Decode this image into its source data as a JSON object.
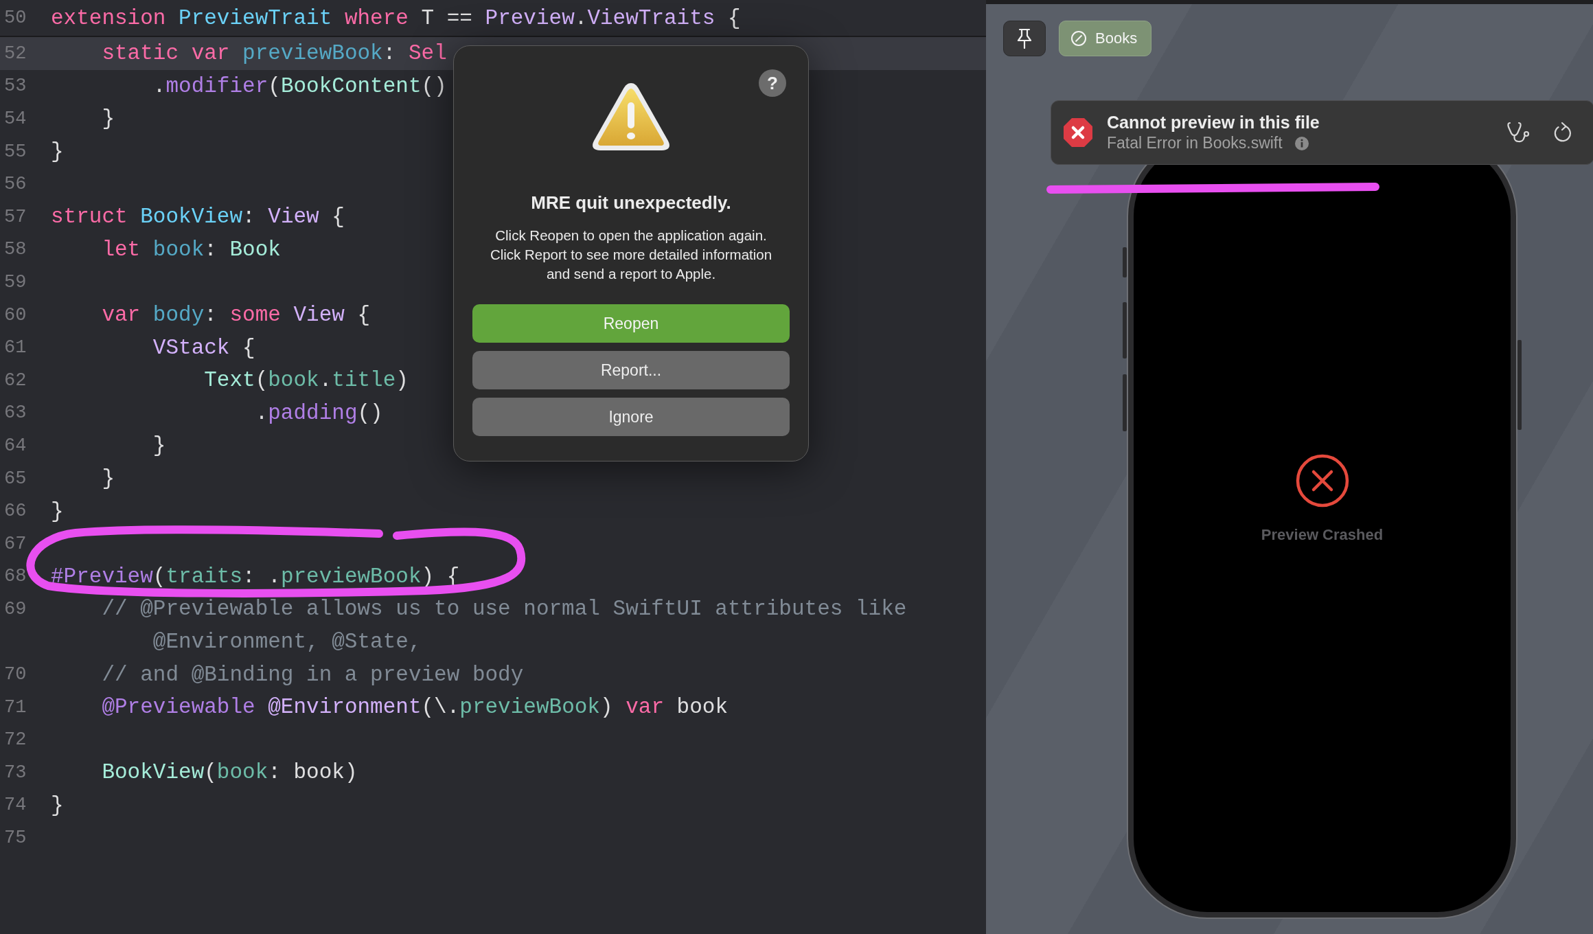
{
  "editor": {
    "sticky_header": {
      "number": "50",
      "tokens": [
        {
          "text": "extension",
          "kind": "keyword"
        },
        {
          "text": " PreviewTrait",
          "kind": "decl-type"
        },
        {
          "text": " where",
          "kind": "keyword"
        },
        {
          "text": " T == ",
          "kind": "plain"
        },
        {
          "text": "Preview",
          "kind": "system-type"
        },
        {
          "text": ".",
          "kind": "plain"
        },
        {
          "text": "ViewTraits",
          "kind": "system-type"
        },
        {
          "text": " {",
          "kind": "plain"
        }
      ]
    },
    "lines": [
      {
        "number": "52",
        "current": true,
        "tokens": [
          {
            "text": "    static",
            "kind": "keyword"
          },
          {
            "text": " var",
            "kind": "keyword"
          },
          {
            "text": " previewBook",
            "kind": "decl-name"
          },
          {
            "text": ": ",
            "kind": "plain"
          },
          {
            "text": "Sel",
            "kind": "keyword"
          }
        ]
      },
      {
        "number": "53",
        "current": false,
        "tokens": [
          {
            "text": "        .",
            "kind": "plain"
          },
          {
            "text": "modifier",
            "kind": "system-func"
          },
          {
            "text": "(",
            "kind": "plain"
          },
          {
            "text": "BookContent",
            "kind": "project-type"
          },
          {
            "text": "()",
            "kind": "plain"
          }
        ]
      },
      {
        "number": "54",
        "current": false,
        "tokens": [
          {
            "text": "    }",
            "kind": "plain"
          }
        ]
      },
      {
        "number": "55",
        "current": false,
        "tokens": [
          {
            "text": "}",
            "kind": "plain"
          }
        ]
      },
      {
        "number": "56",
        "current": false
      },
      {
        "number": "57",
        "current": false,
        "tokens": [
          {
            "text": "struct",
            "kind": "keyword"
          },
          {
            "text": " BookView",
            "kind": "decl-type"
          },
          {
            "text": ": ",
            "kind": "plain"
          },
          {
            "text": "View",
            "kind": "system-type"
          },
          {
            "text": " {",
            "kind": "plain"
          }
        ]
      },
      {
        "number": "58",
        "current": false,
        "tokens": [
          {
            "text": "    let",
            "kind": "keyword"
          },
          {
            "text": " book",
            "kind": "decl-name"
          },
          {
            "text": ": ",
            "kind": "plain"
          },
          {
            "text": "Book",
            "kind": "project-type"
          }
        ]
      },
      {
        "number": "59",
        "current": false
      },
      {
        "number": "60",
        "current": false,
        "tokens": [
          {
            "text": "    var",
            "kind": "keyword"
          },
          {
            "text": " body",
            "kind": "decl-name"
          },
          {
            "text": ": ",
            "kind": "plain"
          },
          {
            "text": "some",
            "kind": "keyword"
          },
          {
            "text": " View",
            "kind": "system-type"
          },
          {
            "text": " {",
            "kind": "plain"
          }
        ]
      },
      {
        "number": "61",
        "current": false,
        "tokens": [
          {
            "text": "        VStack",
            "kind": "system-type"
          },
          {
            "text": " {",
            "kind": "plain"
          }
        ]
      },
      {
        "number": "62",
        "current": false,
        "tokens": [
          {
            "text": "            Text",
            "kind": "project-type"
          },
          {
            "text": "(",
            "kind": "plain"
          },
          {
            "text": "book",
            "kind": "project-prop"
          },
          {
            "text": ".",
            "kind": "plain"
          },
          {
            "text": "title",
            "kind": "project-prop"
          },
          {
            "text": ")",
            "kind": "plain"
          }
        ]
      },
      {
        "number": "63",
        "current": false,
        "tokens": [
          {
            "text": "                .",
            "kind": "plain"
          },
          {
            "text": "padding",
            "kind": "system-func"
          },
          {
            "text": "()",
            "kind": "plain"
          }
        ]
      },
      {
        "number": "64",
        "current": false,
        "tokens": [
          {
            "text": "        }",
            "kind": "plain"
          }
        ]
      },
      {
        "number": "65",
        "current": false,
        "tokens": [
          {
            "text": "    }",
            "kind": "plain"
          }
        ]
      },
      {
        "number": "66",
        "current": false,
        "tokens": [
          {
            "text": "}",
            "kind": "plain"
          }
        ]
      },
      {
        "number": "67",
        "current": false
      },
      {
        "number": "68",
        "current": false,
        "tokens": [
          {
            "text": "#Preview",
            "kind": "system-func"
          },
          {
            "text": "(",
            "kind": "plain"
          },
          {
            "text": "traits",
            "kind": "project-prop"
          },
          {
            "text": ": .",
            "kind": "plain"
          },
          {
            "text": "previewBook",
            "kind": "project-prop"
          },
          {
            "text": ") {",
            "kind": "plain"
          }
        ]
      },
      {
        "number": "69",
        "current": false,
        "tokens": [
          {
            "text": "    // @Previewable allows us to use normal SwiftUI attributes like",
            "kind": "comment"
          }
        ]
      },
      {
        "current": false,
        "tokens": [
          {
            "text": "        @Environment, @State,",
            "kind": "comment"
          }
        ]
      },
      {
        "number": "70",
        "current": false,
        "tokens": [
          {
            "text": "    // and @Binding in a preview body",
            "kind": "comment"
          }
        ]
      },
      {
        "number": "71",
        "current": false,
        "tokens": [
          {
            "text": "    @Previewable",
            "kind": "system-func"
          },
          {
            "text": " @Environment",
            "kind": "system-type"
          },
          {
            "text": "(\\.",
            "kind": "plain"
          },
          {
            "text": "previewBook",
            "kind": "project-prop"
          },
          {
            "text": ") ",
            "kind": "plain"
          },
          {
            "text": "var",
            "kind": "keyword"
          },
          {
            "text": " book",
            "kind": "plain"
          }
        ]
      },
      {
        "number": "72",
        "current": false
      },
      {
        "number": "73",
        "current": false,
        "tokens": [
          {
            "text": "    BookView",
            "kind": "project-type"
          },
          {
            "text": "(",
            "kind": "plain"
          },
          {
            "text": "book",
            "kind": "project-prop"
          },
          {
            "text": ": book)",
            "kind": "plain"
          }
        ]
      },
      {
        "number": "74",
        "current": false,
        "tokens": [
          {
            "text": "}",
            "kind": "plain"
          }
        ]
      },
      {
        "number": "75",
        "current": false
      }
    ]
  },
  "dialog": {
    "help_label": "?",
    "title": "MRE quit unexpectedly.",
    "message": "Click Reopen to open the application again. Click Report to see more detailed information and send a report to Apple.",
    "buttons": [
      {
        "label": "Reopen",
        "kind": "default"
      },
      {
        "label": "Report...",
        "kind": "normal"
      },
      {
        "label": "Ignore",
        "kind": "normal"
      }
    ]
  },
  "preview": {
    "toolbar": {
      "books_button": "Books"
    },
    "error_banner": {
      "title": "Cannot preview in this file",
      "subtitle": "Fatal Error in Books.swift"
    },
    "device": {
      "status": "Preview Crashed"
    }
  }
}
